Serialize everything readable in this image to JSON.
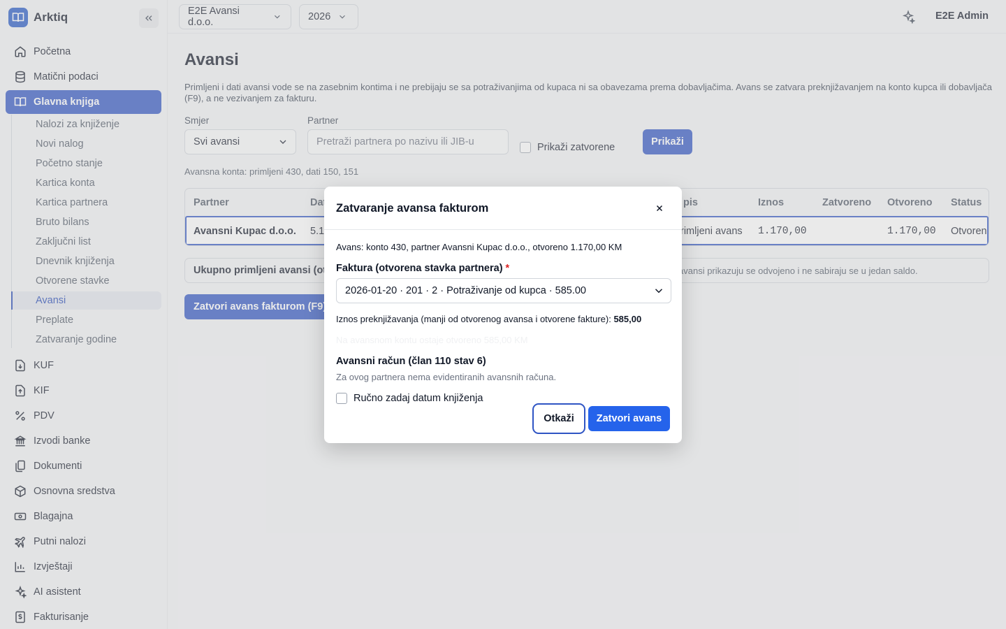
{
  "app": {
    "name": "Arktiq"
  },
  "sidebar": {
    "items": [
      {
        "label": "Početna",
        "icon": "home-icon"
      },
      {
        "label": "Matični podaci",
        "icon": "database-icon"
      },
      {
        "label": "Glavna knjiga",
        "icon": "book-icon",
        "active": true
      },
      {
        "label": "KUF",
        "icon": "file-download-icon"
      },
      {
        "label": "KIF",
        "icon": "file-upload-icon"
      },
      {
        "label": "PDV",
        "icon": "percent-icon"
      },
      {
        "label": "Izvodi banke",
        "icon": "bank-icon"
      },
      {
        "label": "Dokumenti",
        "icon": "documents-icon"
      },
      {
        "label": "Osnovna sredstva",
        "icon": "box-icon"
      },
      {
        "label": "Blagajna",
        "icon": "cash-icon"
      },
      {
        "label": "Putni nalozi",
        "icon": "plane-icon"
      },
      {
        "label": "Izvještaji",
        "icon": "bar-chart-icon"
      },
      {
        "label": "AI asistent",
        "icon": "sparkle-icon"
      },
      {
        "label": "Fakturisanje",
        "icon": "invoice-icon"
      }
    ],
    "subitems": [
      "Nalozi za knjiženje",
      "Novi nalog",
      "Početno stanje",
      "Kartica konta",
      "Kartica partnera",
      "Bruto bilans",
      "Zaključni list",
      "Dnevnik knjiženja",
      "Otvorene stavke",
      "Avansi",
      "Preplate",
      "Zatvaranje godine"
    ],
    "active_sub": "Avansi"
  },
  "topbar": {
    "company": "E2E Avansi d.o.o.",
    "year": "2026",
    "user": "E2E Admin"
  },
  "page": {
    "title": "Avansi",
    "description": "Primljeni i dati avansi vode se na zasebnim kontima i ne prebijaju se sa potraživanjima od kupaca ni sa obavezama prema dobavljačima. Avans se zatvara preknjižavanjem na konto kupca ili dobavljača (F9), a ne vezivanjem za fakturu.",
    "filters": {
      "direction_label": "Smjer",
      "direction_value": "Svi avansi",
      "partner_label": "Partner",
      "partner_placeholder": "Pretraži partnera po nazivu ili JIB-u",
      "show_closed_label": "Prikaži zatvorene",
      "show_button": "Prikaži"
    },
    "accounts_hint": "Avansna konta: primljeni 430, dati 150, 151",
    "table": {
      "headers": {
        "partner": "Partner",
        "date": "Dat",
        "desc": "pis",
        "amount": "Iznos",
        "closed": "Zatvoreno",
        "open": "Otvoreno",
        "status": "Status"
      },
      "rows": [
        {
          "partner": "Avansni Kupac d.o.o.",
          "date": "5.1.",
          "desc": "rimljeni avans",
          "amount": "1.170,00",
          "closed": "",
          "open": "1.170,00",
          "status": "Otvoren"
        }
      ]
    },
    "summary": {
      "left": "Ukupno primljeni avansi (otv",
      "right": "avansi prikazuju se odvojeno i ne sabiraju se u jedan saldo."
    },
    "close_button": "Zatvori avans fakturom (F9)"
  },
  "modal": {
    "title": "Zatvaranje avansa fakturom",
    "info": "Avans: konto 430, partner Avansni Kupac d.o.o., otvoreno 1.170,00 KM",
    "invoice_label": "Faktura (otvorena stavka partnera)",
    "required_mark": "*",
    "invoice_value": "2026-01-20 · 201 · 2 · Potraživanje od kupca · 585.00",
    "amount_text": "Iznos preknjižavanja (manji od otvorenog avansa i otvorene fakture):",
    "amount_value": "585,00",
    "faded_text": "Na avansnom kontu ostaje otvoreno 585,00 KM",
    "advance_invoice_title": "Avansni račun (član 110 stav 6)",
    "advance_invoice_note": "Za ovog partnera nema evidentiranih avansnih računa.",
    "manual_date_label": "Ručno zadaj datum knjiženja",
    "cancel": "Otkaži",
    "confirm": "Zatvori avans"
  }
}
